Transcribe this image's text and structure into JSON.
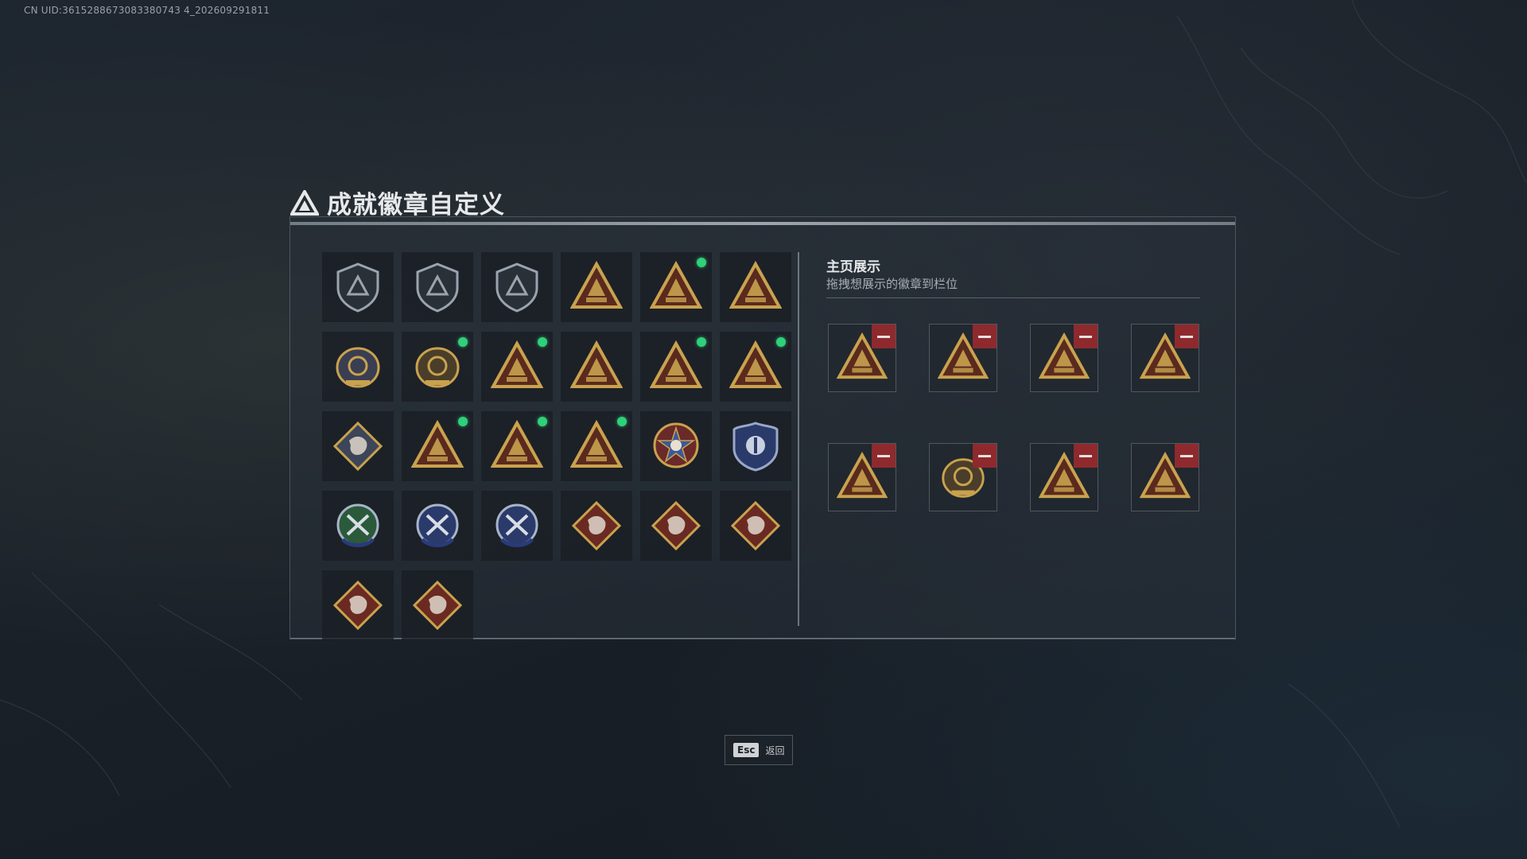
{
  "uid_text": "CN UID:3615288673083380743 4_202609291811",
  "title": "成就徽章自定义",
  "showcase": {
    "title": "主页展示",
    "subtitle": "拖拽想展示的徽章到栏位"
  },
  "badges": [
    {
      "icon": "shield-triangle-icon",
      "shape": "shield",
      "color": "#2a3038",
      "new": false
    },
    {
      "icon": "helicopter-shield-icon",
      "shape": "shield",
      "color": "#2a3038",
      "new": false
    },
    {
      "icon": "jet-shield-icon",
      "shape": "shield",
      "color": "#2a3038",
      "new": false
    },
    {
      "icon": "skull-hat-badge-icon",
      "shape": "triangle",
      "color": "#5a2a1e",
      "new": false
    },
    {
      "icon": "tank-badge-icon",
      "shape": "triangle",
      "color": "#5a2a1e",
      "new": true
    },
    {
      "icon": "number-two-badge-icon",
      "shape": "triangle",
      "color": "#5a2a1e",
      "new": false
    },
    {
      "icon": "dragon-crest-icon",
      "shape": "crest",
      "color": "#3a3e52",
      "new": false
    },
    {
      "icon": "emblem-2020-icon",
      "shape": "crest",
      "color": "#4a3e2a",
      "new": true
    },
    {
      "icon": "crate-badge-icon",
      "shape": "triangle",
      "color": "#5a2a1e",
      "new": true
    },
    {
      "icon": "soldiers-badge-icon",
      "shape": "triangle",
      "color": "#5a2a1e",
      "new": false
    },
    {
      "icon": "soldier-group-badge-icon",
      "shape": "triangle",
      "color": "#5a2a1e",
      "new": true
    },
    {
      "icon": "rocket-badge-icon",
      "shape": "triangle",
      "color": "#5a2a1e",
      "new": true
    },
    {
      "icon": "cube-diamond-icon",
      "shape": "diamond",
      "color": "#3c4658",
      "new": false
    },
    {
      "icon": "runner-badge-icon",
      "shape": "triangle",
      "color": "#5a2a1e",
      "new": true
    },
    {
      "icon": "medic-badge-icon",
      "shape": "triangle",
      "color": "#5a2a1e",
      "new": true
    },
    {
      "icon": "gas-mask-badge-icon",
      "shape": "triangle",
      "color": "#5a2a1e",
      "new": true
    },
    {
      "icon": "skull-star-medal-icon",
      "shape": "medal",
      "color": "#6a2a2a",
      "new": false
    },
    {
      "icon": "blue-police-badge-icon",
      "shape": "police",
      "color": "#2a3a6a",
      "new": false
    },
    {
      "icon": "green-shield-crest-icon",
      "shape": "round",
      "color": "#2a5a3a",
      "new": false
    },
    {
      "icon": "blue-sword-crest-icon",
      "shape": "round",
      "color": "#2a3a6a",
      "new": false
    },
    {
      "icon": "blue-cycle-crest-icon",
      "shape": "round",
      "color": "#2a3a6a",
      "new": false
    },
    {
      "icon": "wolf-diamond-icon",
      "shape": "diamond",
      "color": "#6a2a22",
      "new": false
    },
    {
      "icon": "wolf-howl-diamond-icon",
      "shape": "diamond",
      "color": "#6a2a22",
      "new": false
    },
    {
      "icon": "eagle-diamond-icon",
      "shape": "diamond",
      "color": "#6a2a22",
      "new": false
    },
    {
      "icon": "dragon-diamond-icon",
      "shape": "diamond",
      "color": "#6a2a22",
      "new": false
    },
    {
      "icon": "beast-diamond-icon",
      "shape": "diamond",
      "color": "#6a2a22",
      "new": false
    }
  ],
  "slots": [
    {
      "icon": "rocket-badge-icon",
      "color": "#5a2a1e"
    },
    {
      "icon": "soldier-group-badge-icon",
      "color": "#5a2a1e"
    },
    {
      "icon": "tank-badge-icon",
      "color": "#5a2a1e"
    },
    {
      "icon": "gas-mask-badge-icon",
      "color": "#5a2a1e"
    },
    {
      "icon": "runner-badge-icon",
      "color": "#5a2a1e"
    },
    {
      "icon": "emblem-2020-icon",
      "color": "#4a3e2a"
    },
    {
      "icon": "medic-badge-icon",
      "color": "#5a2a1e"
    },
    {
      "icon": "crate-badge-icon",
      "color": "#5a2a1e"
    }
  ],
  "esc": {
    "key": "Esc",
    "label": "返回"
  },
  "colors": {
    "gold": "#c9a24e",
    "new_dot": "#2fd07a",
    "remove": "#8e2a2e"
  }
}
